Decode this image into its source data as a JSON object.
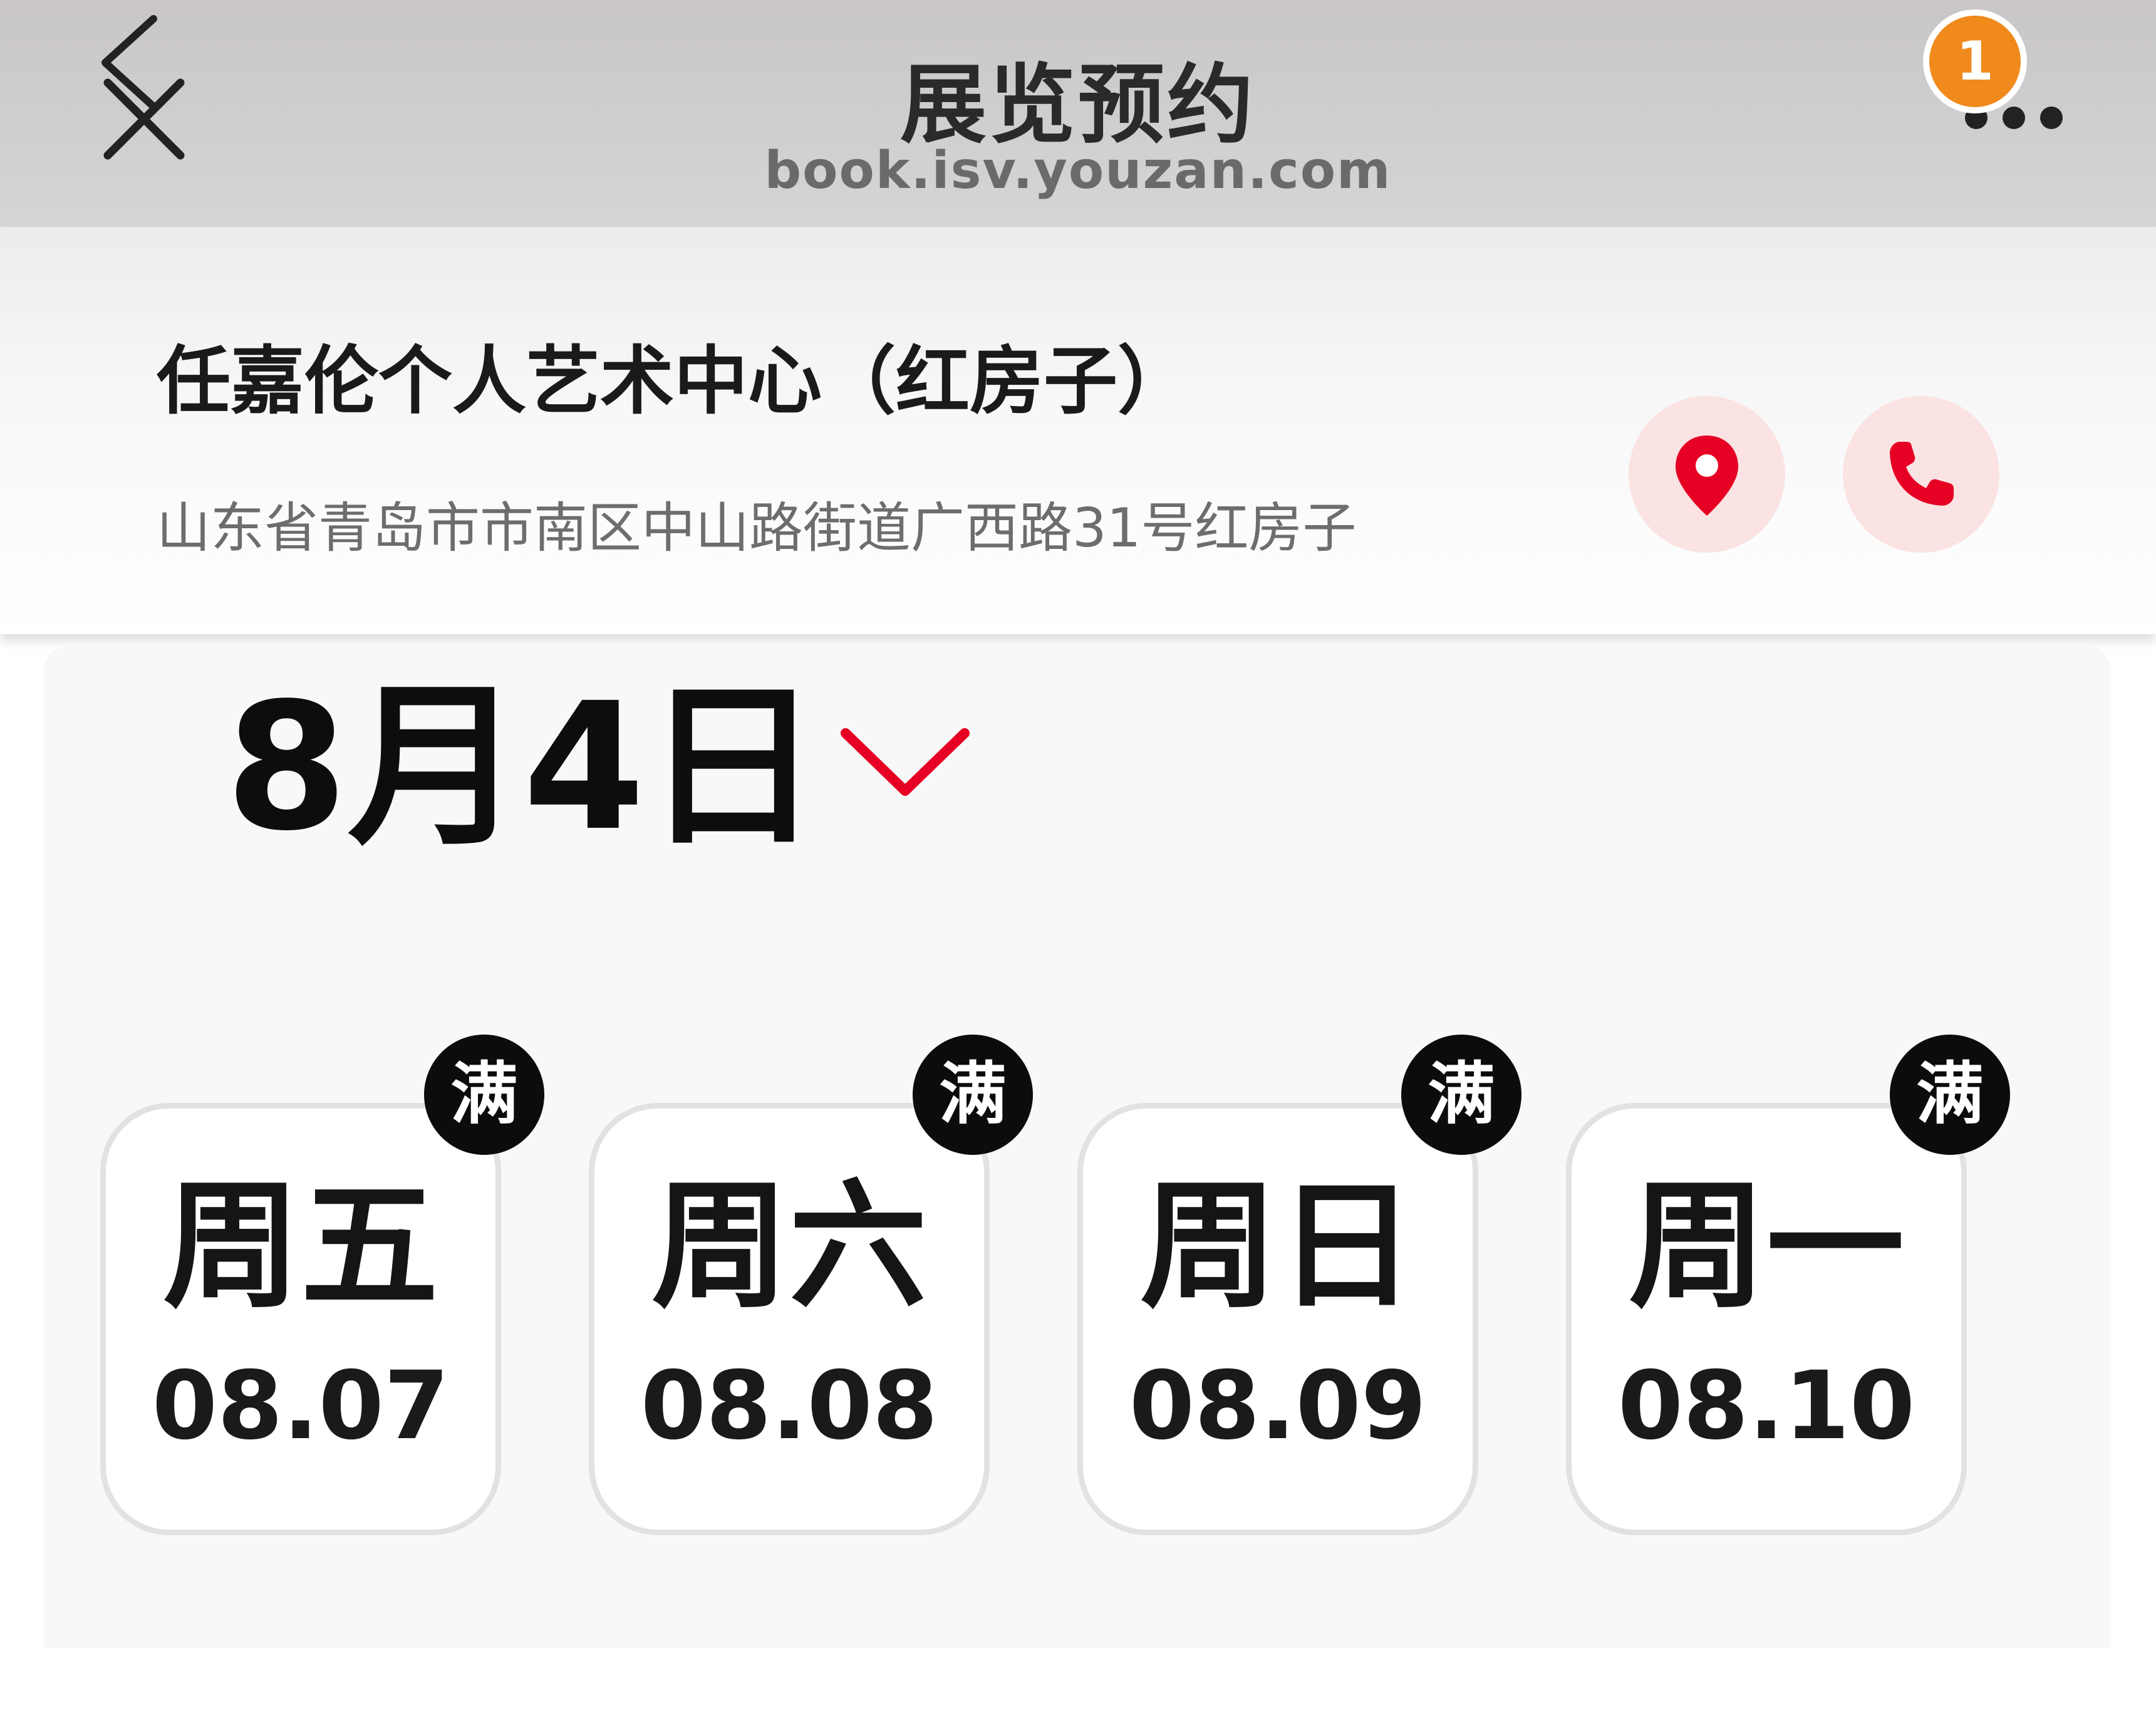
{
  "nav": {
    "title": "展览预约",
    "url": "book.isv.youzan.com",
    "badge_count": "1",
    "back_icon": "chevron-left-icon",
    "close_icon": "close-icon",
    "more_icon": "more-dots-icon"
  },
  "venue": {
    "name": "任嘉伦个人艺术中心（红房子）",
    "address": "山东省青岛市市南区中山路街道广西路31号红房子",
    "location_icon": "location-pin-icon",
    "phone_icon": "phone-icon"
  },
  "date_selector": {
    "current": "8月4日",
    "chevron_icon": "chevron-down-icon"
  },
  "days": [
    {
      "weekday": "周五",
      "date": "08.07",
      "status": "满"
    },
    {
      "weekday": "周六",
      "date": "08.08",
      "status": "满"
    },
    {
      "weekday": "周日",
      "date": "08.09",
      "status": "满"
    },
    {
      "weekday": "周一",
      "date": "08.10",
      "status": "满"
    }
  ],
  "colors": {
    "accent_red": "#e60023",
    "badge_orange": "#f08a1c",
    "icon_circle_bg": "#fbe3e3"
  }
}
